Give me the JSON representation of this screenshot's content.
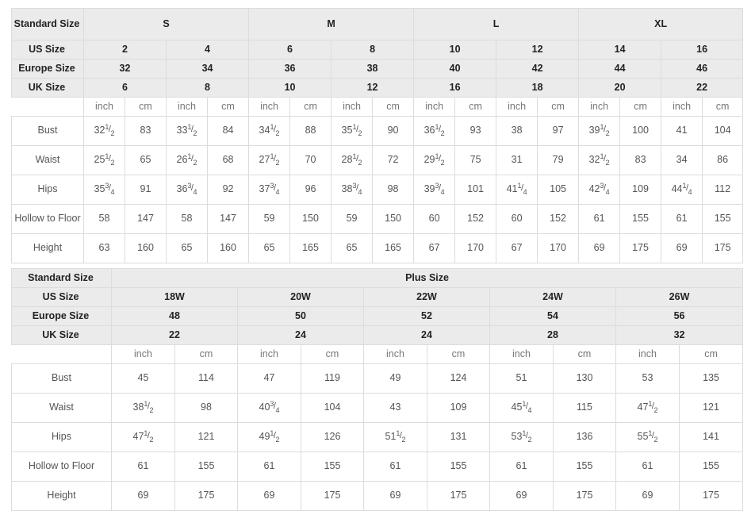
{
  "regular": {
    "standard_size_label": "Standard Size",
    "us_size_label": "US Size",
    "europe_size_label": "Europe Size",
    "uk_size_label": "UK Size",
    "size_groups": [
      "S",
      "M",
      "L",
      "XL"
    ],
    "us_sizes": [
      "2",
      "4",
      "6",
      "8",
      "10",
      "12",
      "14",
      "16"
    ],
    "europe_sizes": [
      "32",
      "34",
      "36",
      "38",
      "40",
      "42",
      "44",
      "46"
    ],
    "uk_sizes": [
      "6",
      "8",
      "10",
      "12",
      "16",
      "18",
      "20",
      "22"
    ],
    "unit_inch": "inch",
    "unit_cm": "cm",
    "rows": [
      {
        "label": "Bust",
        "inch": [
          "32 1/2",
          "33 1/2",
          "34 1/2",
          "35 1/2",
          "36 1/2",
          "38",
          "39 1/2",
          "41"
        ],
        "cm": [
          "83",
          "84",
          "88",
          "90",
          "93",
          "97",
          "100",
          "104"
        ]
      },
      {
        "label": "Waist",
        "inch": [
          "25 1/2",
          "26 1/2",
          "27 1/2",
          "28 1/2",
          "29 1/2",
          "31",
          "32 1/2",
          "34"
        ],
        "cm": [
          "65",
          "68",
          "70",
          "72",
          "75",
          "79",
          "83",
          "86"
        ]
      },
      {
        "label": "Hips",
        "inch": [
          "35 3/4",
          "36 3/4",
          "37 3/4",
          "38 3/4",
          "39 3/4",
          "41 1/4",
          "42 3/4",
          "44 1/4"
        ],
        "cm": [
          "91",
          "92",
          "96",
          "98",
          "101",
          "105",
          "109",
          "112"
        ]
      },
      {
        "label": "Hollow to Floor",
        "inch": [
          "58",
          "58",
          "59",
          "59",
          "60",
          "60",
          "61",
          "61"
        ],
        "cm": [
          "147",
          "147",
          "150",
          "150",
          "152",
          "152",
          "155",
          "155"
        ]
      },
      {
        "label": "Height",
        "inch": [
          "63",
          "65",
          "65",
          "65",
          "67",
          "67",
          "69",
          "69"
        ],
        "cm": [
          "160",
          "160",
          "165",
          "165",
          "170",
          "170",
          "175",
          "175"
        ]
      }
    ]
  },
  "plus": {
    "standard_size_label": "Standard Size",
    "plus_size_label": "Plus Size",
    "us_size_label": "US Size",
    "europe_size_label": "Europe Size",
    "uk_size_label": "UK Size",
    "us_sizes": [
      "18W",
      "20W",
      "22W",
      "24W",
      "26W"
    ],
    "europe_sizes": [
      "48",
      "50",
      "52",
      "54",
      "56"
    ],
    "uk_sizes": [
      "22",
      "24",
      "24",
      "28",
      "32"
    ],
    "unit_inch": "inch",
    "unit_cm": "cm",
    "rows": [
      {
        "label": "Bust",
        "inch": [
          "45",
          "47",
          "49",
          "51",
          "53"
        ],
        "cm": [
          "114",
          "119",
          "124",
          "130",
          "135"
        ]
      },
      {
        "label": "Waist",
        "inch": [
          "38 1/2",
          "40 3/4",
          "43",
          "45 1/4",
          "47 1/2"
        ],
        "cm": [
          "98",
          "104",
          "109",
          "115",
          "121"
        ]
      },
      {
        "label": "Hips",
        "inch": [
          "47 1/2",
          "49 1/2",
          "51 1/2",
          "53 1/2",
          "55 1/2"
        ],
        "cm": [
          "121",
          "126",
          "131",
          "136",
          "141"
        ]
      },
      {
        "label": "Hollow to Floor",
        "inch": [
          "61",
          "61",
          "61",
          "61",
          "61"
        ],
        "cm": [
          "155",
          "155",
          "155",
          "155",
          "155"
        ]
      },
      {
        "label": "Height",
        "inch": [
          "69",
          "69",
          "69",
          "69",
          "69"
        ],
        "cm": [
          "175",
          "175",
          "175",
          "175",
          "175"
        ]
      }
    ]
  },
  "colors": {
    "header_bg": "#ebebeb",
    "border": "#dcdcdc",
    "text": "#555555",
    "header_text": "#222222",
    "page_bg": "#ffffff"
  }
}
